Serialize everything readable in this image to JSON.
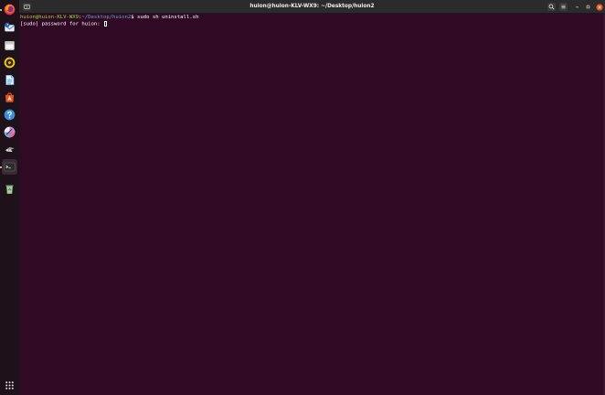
{
  "window": {
    "title": "huion@huion-KLV-WX9: ~/Desktop/huion2"
  },
  "terminal": {
    "lines": [
      {
        "user_host": "huion@huion-KLV-WX9",
        "sep1": ":",
        "path": "~/Desktop/huion2",
        "prompt_symbol": "$ ",
        "command": "sudo sh uninstall.sh"
      },
      {
        "text": "[sudo] password for huion: "
      }
    ]
  },
  "dock": {
    "items": [
      {
        "name": "firefox-icon",
        "color": "#e66000"
      },
      {
        "name": "thunderbird-icon",
        "color": "#3b7fd9"
      },
      {
        "name": "files-icon",
        "color": "#d9d9d9"
      },
      {
        "name": "rhythmbox-icon",
        "color": "#f2c21b"
      },
      {
        "name": "libreoffice-writer-icon",
        "color": "#3a8fd8"
      },
      {
        "name": "software-center-icon",
        "color": "#e95420"
      },
      {
        "name": "help-icon",
        "color": "#3a8fd8"
      },
      {
        "name": "huion-tablet-icon",
        "color": "#c48cd8"
      },
      {
        "name": "app-icon",
        "color": "#888888"
      },
      {
        "name": "terminal-icon",
        "color": "#2d2d2d"
      },
      {
        "name": "trash-icon",
        "color": "#7aa86d"
      },
      {
        "name": "show-applications-icon",
        "color": "#e0e0e0"
      }
    ]
  }
}
